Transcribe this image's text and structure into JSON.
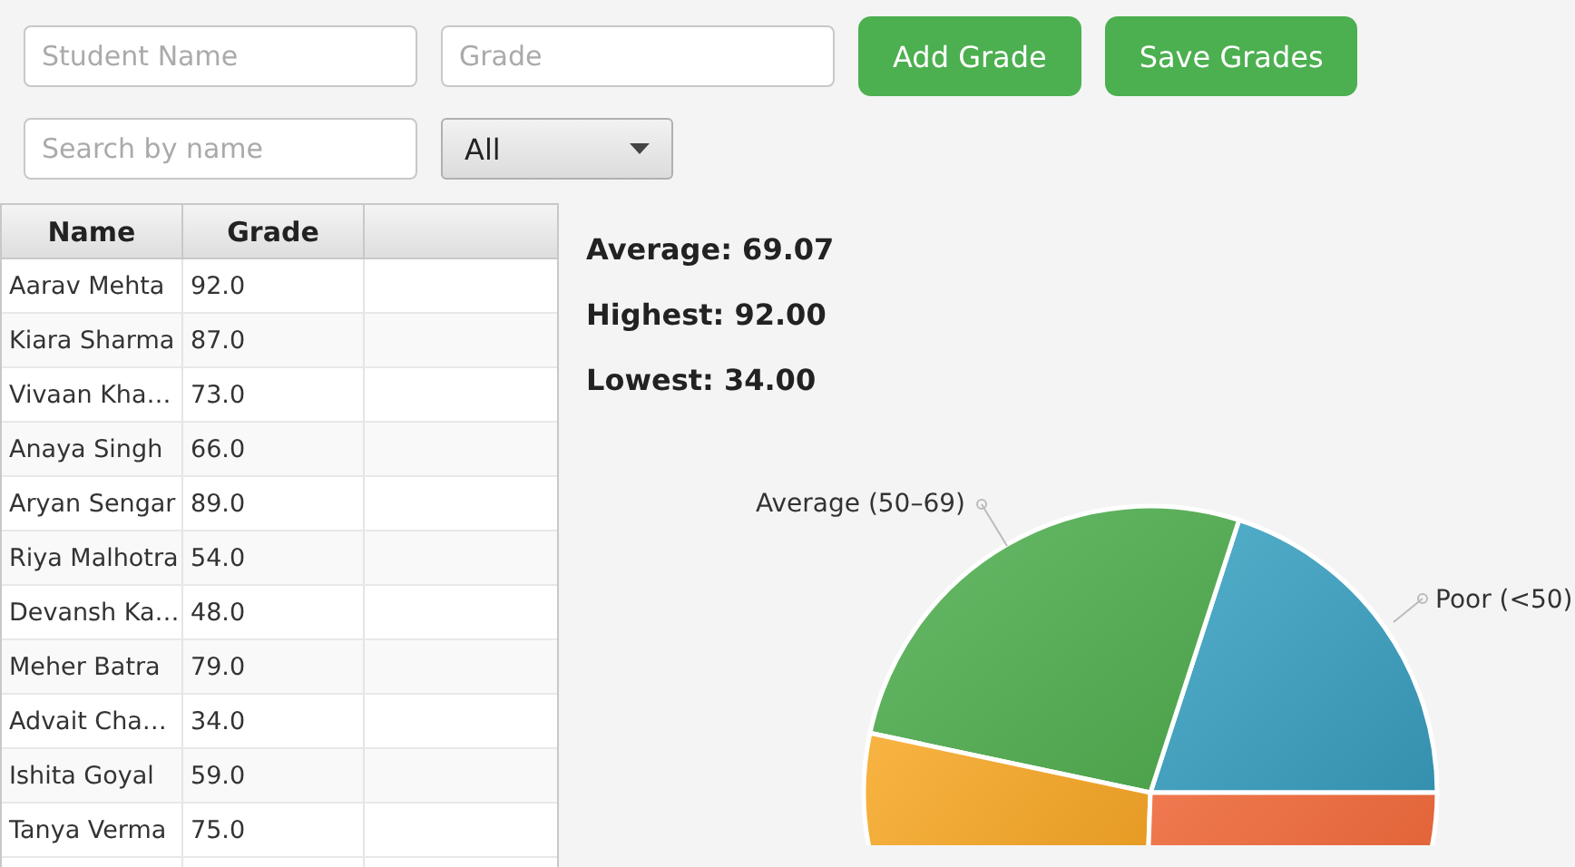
{
  "form": {
    "name_field": {
      "placeholder": "Student Name"
    },
    "grade_field": {
      "placeholder": "Grade"
    },
    "buttons": [
      "Add Grade",
      "Save Grades"
    ]
  },
  "filter": {
    "search_field": {
      "placeholder": "Search by name"
    },
    "dropdown": {
      "value": "All"
    }
  },
  "table": {
    "columns": [
      "Name",
      "Grade"
    ],
    "rows": [
      [
        "Aarav Mehta",
        "92.0"
      ],
      [
        "Kiara Sharma",
        "87.0"
      ],
      [
        "Vivaan Kha…",
        "73.0"
      ],
      [
        "Anaya Singh",
        "66.0"
      ],
      [
        "Aryan Sengar",
        "89.0"
      ],
      [
        "Riya Malhotra",
        "54.0"
      ],
      [
        "Devansh Ka…",
        "48.0"
      ],
      [
        "Meher Batra",
        "79.0"
      ],
      [
        "Advait Cha…",
        "34.0"
      ],
      [
        "Ishita Goyal",
        "59.0"
      ],
      [
        "Tanya Verma",
        "75.0"
      ]
    ]
  },
  "stats": [
    "Average: 69.07",
    "Highest: 92.00",
    "Lowest: 34.00"
  ],
  "pie": {
    "labels": [
      {
        "text": "Average (50–69)",
        "kind": "left"
      },
      {
        "text": "Poor (<50)",
        "kind": "right"
      }
    ]
  }
}
